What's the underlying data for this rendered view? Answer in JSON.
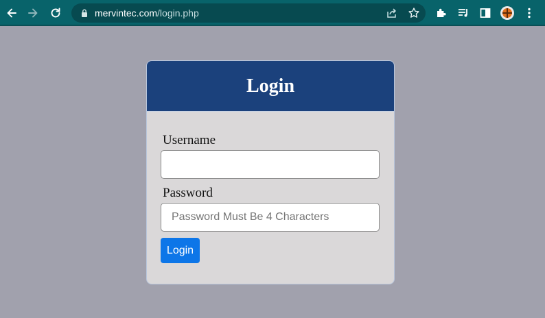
{
  "browser": {
    "url_domain": "mervintec.com",
    "url_path": "/login.php",
    "icons": [
      "back-icon",
      "forward-icon",
      "reload-icon",
      "lock-icon",
      "share-icon",
      "star-icon",
      "extensions-icon",
      "media-icon",
      "side-panel-icon",
      "avatar",
      "menu-icon"
    ],
    "toolbar_color": "#08636a"
  },
  "login": {
    "title": "Login",
    "username_label": "Username",
    "username_value": "",
    "password_label": "Password",
    "password_placeholder": "Password Must Be 4 Characters",
    "button_label": "Login"
  },
  "colors": {
    "header": "#1b417c",
    "button": "#0d76e8",
    "background": "#a1a1ad",
    "card": "#dad8d9"
  }
}
